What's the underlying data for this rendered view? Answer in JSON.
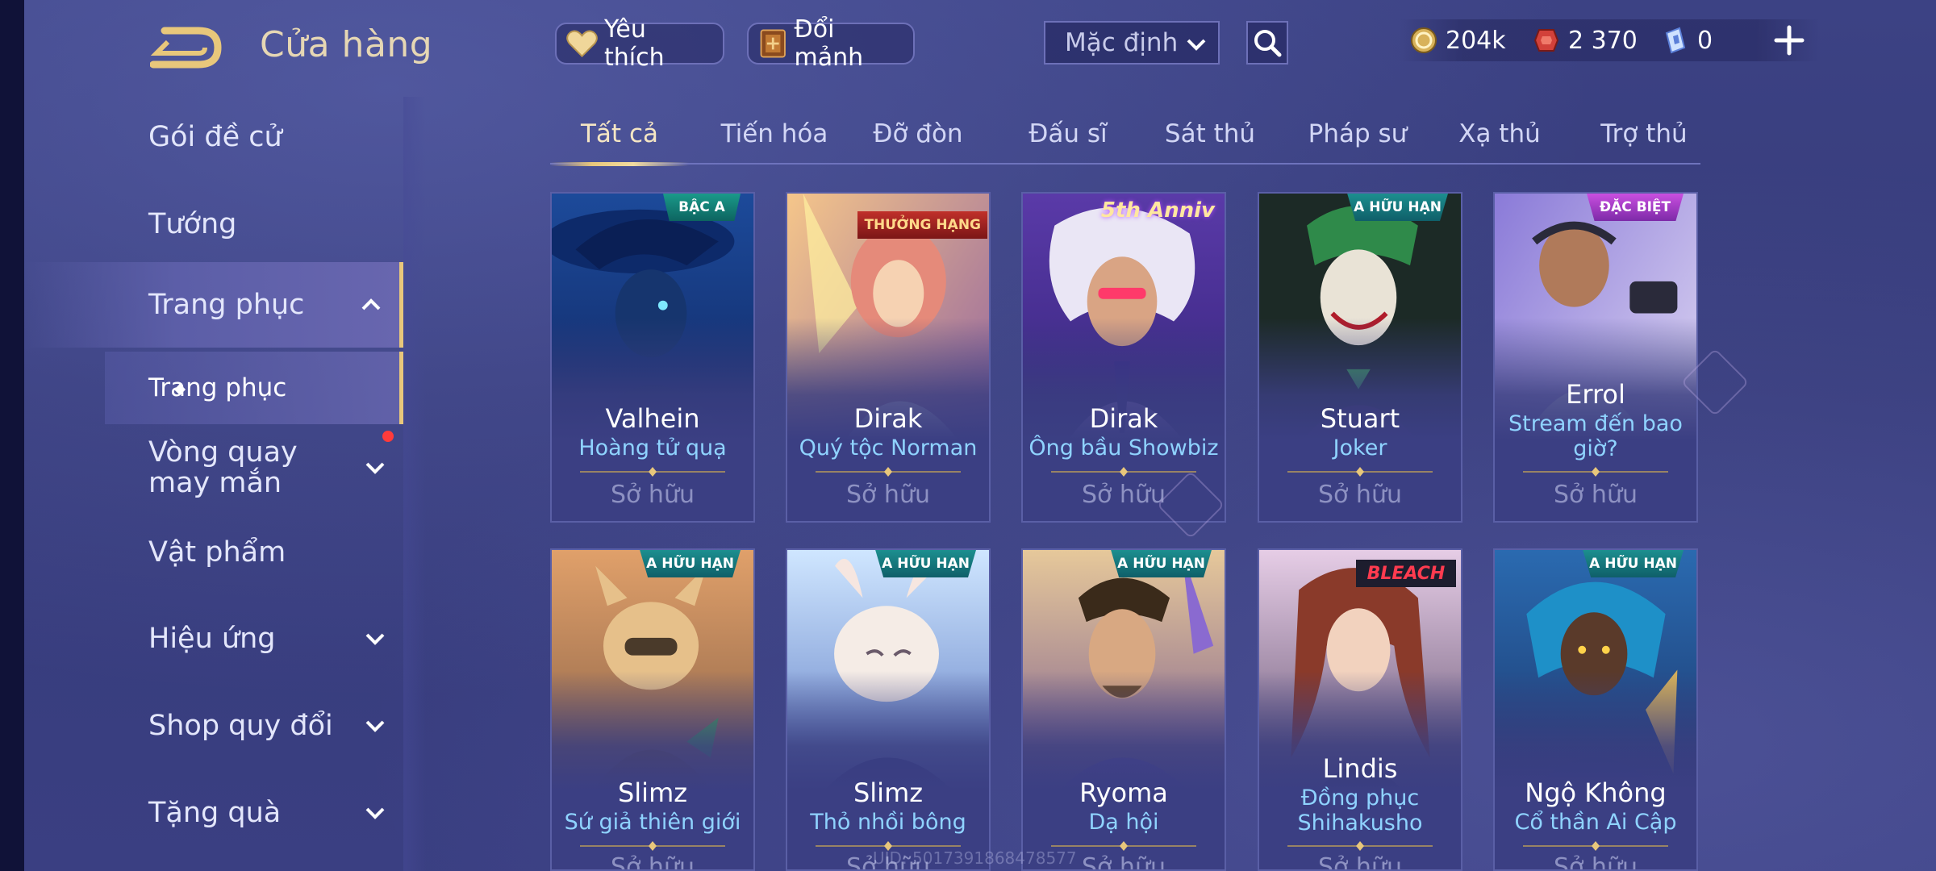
{
  "header": {
    "title": "Cửa hàng",
    "favorites_label": "Yêu thích",
    "exchange_label": "Đổi mảnh",
    "sort_value": "Mặc định"
  },
  "currency": {
    "gold": "204k",
    "vouchers": "2 370",
    "tokens": "0"
  },
  "sidebar": {
    "items": [
      {
        "label": "Gói đề cử"
      },
      {
        "label": "Tướng"
      },
      {
        "label": "Trang phục"
      },
      {
        "label": "Vòng quay may mắn"
      },
      {
        "label": "Vật phẩm"
      },
      {
        "label": "Hiệu ứng"
      },
      {
        "label": "Shop quy đổi"
      },
      {
        "label": "Tặng quà"
      }
    ],
    "sub_item": "Trang phục"
  },
  "tabs": [
    "Tất cả",
    "Tiến hóa",
    "Đỡ đòn",
    "Đấu sĩ",
    "Sát thủ",
    "Pháp sư",
    "Xạ thủ",
    "Trợ thủ"
  ],
  "cards": [
    {
      "hero": "Valhein",
      "skin": "Hoàng tử quạ",
      "status": "Sở hữu",
      "badge": "BẬC A"
    },
    {
      "hero": "Dirak",
      "skin": "Quý tộc Norman",
      "status": "Sở hữu",
      "badge": "THƯỞNG HẠNG"
    },
    {
      "hero": "Dirak",
      "skin": "Ông bầu Showbiz",
      "status": "Sở hữu",
      "badge": "5th Anniv"
    },
    {
      "hero": "Stuart",
      "skin": "Joker",
      "status": "Sở hữu",
      "badge": "A HỮU HẠN"
    },
    {
      "hero": "Errol",
      "skin": "Stream đến bao giờ?",
      "status": "Sở hữu",
      "badge": "ĐẶC BIỆT"
    },
    {
      "hero": "Slimz",
      "skin": "Sứ giả thiên giới",
      "status": "Sở hữu",
      "badge": "A HỮU HẠN"
    },
    {
      "hero": "Slimz",
      "skin": "Thỏ nhồi bông",
      "status": "Sở hữu",
      "badge": "A HỮU HẠN"
    },
    {
      "hero": "Ryoma",
      "skin": "Dạ hội",
      "status": "Sở hữu",
      "badge": "A HỮU HẠN"
    },
    {
      "hero": "Lindis",
      "skin": "Đồng phục Shihakusho",
      "status": "Sở hữu",
      "badge": "BLEACH"
    },
    {
      "hero": "Ngộ Không",
      "skin": "Cổ thần Ai Cập",
      "status": "Sở hữu",
      "badge": "A HỮU HẠN"
    }
  ],
  "uid": "UID: 5017391868478577",
  "colors": {
    "background": "#3a3f7e",
    "accent_gold": "#e8c77b",
    "skin_name": "#8fd3ff",
    "notification": "#ff3b3b"
  },
  "icons": [
    "back-arrow-icon",
    "heart-icon",
    "exchange-icon",
    "chevron-down-icon",
    "search-icon",
    "gold-coin-icon",
    "voucher-icon",
    "token-icon",
    "plus-icon",
    "chevron-up-icon"
  ]
}
